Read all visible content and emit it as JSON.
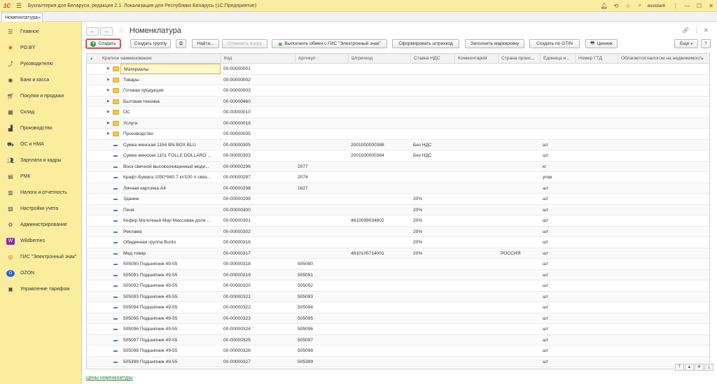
{
  "titlebar": {
    "logo": "1С",
    "title": "Бухгалтерия для Беларуси, редакция 2.1. Локализация для Республики Беларусь  (1С:Предприятие)",
    "user": "assistant"
  },
  "tab": {
    "label": "Номенклатура"
  },
  "sidebar": {
    "items": [
      {
        "label": "Главное",
        "icon": "menu-icon"
      },
      {
        "label": "PO.BY",
        "icon": "sun-icon"
      },
      {
        "label": "Руководителю",
        "icon": "chart-icon"
      },
      {
        "label": "Банк и касса",
        "icon": "coin-icon"
      },
      {
        "label": "Покупки и продажи",
        "icon": "cart-icon"
      },
      {
        "label": "Склад",
        "icon": "warehouse-icon"
      },
      {
        "label": "Производство",
        "icon": "factory-icon"
      },
      {
        "label": "ОС и НМА",
        "icon": "truck-icon"
      },
      {
        "label": "Зарплата и кадры",
        "icon": "people-icon"
      },
      {
        "label": "РМК",
        "icon": "register-icon"
      },
      {
        "label": "Налоги и отчетность",
        "icon": "report-icon"
      },
      {
        "label": "Настройки учета",
        "icon": "settings-doc-icon"
      },
      {
        "label": "Администрирование",
        "icon": "gear-icon"
      },
      {
        "label": "Wildberries",
        "icon": "wildberries-icon"
      },
      {
        "label": "ГИС \"Электронный знак\"",
        "icon": "gis-icon"
      },
      {
        "label": "OZON",
        "icon": "ozon-icon"
      },
      {
        "label": "Управление тарифом",
        "icon": "tariff-icon"
      }
    ]
  },
  "page": {
    "title": "Номенклатура"
  },
  "toolbar": {
    "create": "Создать",
    "create_group": "Создать группу",
    "find": "Найти...",
    "cancel_search": "Отменить поиск",
    "gis_exchange": "Выполнить обмен с ГИС \"Электронный знак\"",
    "barcode": "Сформировать штрихкод",
    "marking": "Заполнить маркировку",
    "gtin": "Создать по GTIN",
    "price_tag": "Ценник",
    "more": "Еще",
    "help": "?"
  },
  "table": {
    "columns": [
      "Краткое наименование",
      "Код",
      "Артикул",
      "Штрихкод",
      "Ставка НДС",
      "Комментарий",
      "Страна проис...",
      "Единица и...",
      "Номер ГТД",
      "Облагается налогом на недвижимость"
    ],
    "rows": [
      {
        "type": "group",
        "name": "Материалы",
        "code": "00-00000001",
        "article": "",
        "barcode": "",
        "vat": "",
        "country": "",
        "unit": ""
      },
      {
        "type": "group",
        "name": "Товары",
        "code": "00-00000002",
        "article": "",
        "barcode": "",
        "vat": "",
        "country": "",
        "unit": ""
      },
      {
        "type": "group",
        "name": "Готовая продукция",
        "code": "00-00000003",
        "article": "",
        "barcode": "",
        "vat": "",
        "country": "",
        "unit": ""
      },
      {
        "type": "group",
        "name": "Бытовая техника",
        "code": "00-00000460",
        "article": "",
        "barcode": "",
        "vat": "",
        "country": "",
        "unit": ""
      },
      {
        "type": "group",
        "name": "ОС",
        "code": "00-00000010",
        "article": "",
        "barcode": "",
        "vat": "",
        "country": "",
        "unit": ""
      },
      {
        "type": "group",
        "name": "Услуги",
        "code": "00-00000016",
        "article": "",
        "barcode": "",
        "vat": "",
        "country": "",
        "unit": ""
      },
      {
        "type": "group",
        "name": "Производство",
        "code": "00-00000035",
        "article": "",
        "barcode": "",
        "vat": "",
        "country": "",
        "unit": ""
      },
      {
        "type": "item",
        "name": "Сумка женская 1154 BN BOX BLU",
        "code": "00-00000305",
        "article": "",
        "barcode": "2001000000388",
        "vat": "Без НДС",
        "country": "",
        "unit": "шт"
      },
      {
        "type": "item",
        "name": "Сумка женская 1101 FOLLE DOLLARO ...",
        "code": "00-00000303",
        "article": "",
        "barcode": "2001000000364",
        "vat": "Без НДС",
        "country": "",
        "unit": "шт"
      },
      {
        "type": "item",
        "name": " Воск свечной высокоочищенный моди...",
        "code": "00-00000296",
        "article": "2077",
        "barcode": "",
        "vat": "",
        "country": "",
        "unit": "кг"
      },
      {
        "type": "item",
        "name": " Крафт-Бумага 1050*840 7 кг/100 л связ...",
        "code": "00-00000297",
        "article": "2074",
        "barcode": "",
        "vat": "",
        "country": "",
        "unit": "упак"
      },
      {
        "type": "item",
        "name": " Личная карточка А4",
        "code": "00-00000298",
        "article": "1627",
        "barcode": "",
        "vat": "",
        "country": "",
        "unit": "шт"
      },
      {
        "type": "item",
        "name": "Здание",
        "code": "00-00000299",
        "article": "",
        "barcode": "",
        "vat": "20%",
        "country": "",
        "unit": "шт"
      },
      {
        "type": "item",
        "name": "Пеня",
        "code": "00-00000300",
        "article": "",
        "barcode": "",
        "vat": "20%",
        "country": "",
        "unit": "шт"
      },
      {
        "type": "item",
        "name": "Кефир Молочный Мир Массовая доля ...",
        "code": "00-00000301",
        "article": "",
        "barcode": "4810099034802",
        "vat": "20%",
        "country": "",
        "unit": "шт"
      },
      {
        "type": "item",
        "name": "Реклама",
        "code": "00-00000302",
        "article": "",
        "barcode": "",
        "vat": "20%",
        "country": "",
        "unit": "шт"
      },
      {
        "type": "item",
        "name": "Обеденная группа Burito",
        "code": "00-00000316",
        "article": "",
        "barcode": "",
        "vat": "20%",
        "country": "",
        "unit": "шт"
      },
      {
        "type": "item",
        "name": "Мед товар",
        "code": "00-00000317",
        "article": "",
        "barcode": "4810105714001",
        "vat": "20%",
        "country": "РОССИЯ",
        "unit": "шт"
      },
      {
        "type": "item",
        "name": "505090 Подшипник 49-55",
        "code": "00-00000318",
        "article": "505090",
        "barcode": "",
        "vat": "",
        "country": "",
        "unit": "шт"
      },
      {
        "type": "item",
        "name": "505091 Подшипник 49-55",
        "code": "00-00000319",
        "article": "505091",
        "barcode": "",
        "vat": "",
        "country": "",
        "unit": "шт"
      },
      {
        "type": "item",
        "name": "505092 Подшипник 49-55",
        "code": "00-00000320",
        "article": "505092",
        "barcode": "",
        "vat": "",
        "country": "",
        "unit": "шт"
      },
      {
        "type": "item",
        "name": "505093 Подшипник 49-55",
        "code": "00-00000321",
        "article": "505093",
        "barcode": "",
        "vat": "",
        "country": "",
        "unit": "шт"
      },
      {
        "type": "item",
        "name": "505094 Подшипник 49-55",
        "code": "00-00000322",
        "article": "505094",
        "barcode": "",
        "vat": "",
        "country": "",
        "unit": "шт"
      },
      {
        "type": "item",
        "name": "505095 Подшипник 49-55",
        "code": "00-00000323",
        "article": "505095",
        "barcode": "",
        "vat": "",
        "country": "",
        "unit": "шт"
      },
      {
        "type": "item",
        "name": "505096 Подшипник 49-55",
        "code": "00-00000324",
        "article": "505096",
        "barcode": "",
        "vat": "",
        "country": "",
        "unit": "шт"
      },
      {
        "type": "item",
        "name": "505097 Подшипник 49-55",
        "code": "00-00000325",
        "article": "505097",
        "barcode": "",
        "vat": "",
        "country": "",
        "unit": "шт"
      },
      {
        "type": "item",
        "name": "505098 Подшипник 49-55",
        "code": "00-00000326",
        "article": "505098",
        "barcode": "",
        "vat": "",
        "country": "",
        "unit": "шт"
      },
      {
        "type": "item",
        "name": "505399 Подшипник 49-55",
        "code": "00-00000327",
        "article": "505399",
        "barcode": "",
        "vat": "",
        "country": "",
        "unit": "шт"
      }
    ]
  },
  "footer": {
    "link": "Цены номенклатуры"
  }
}
